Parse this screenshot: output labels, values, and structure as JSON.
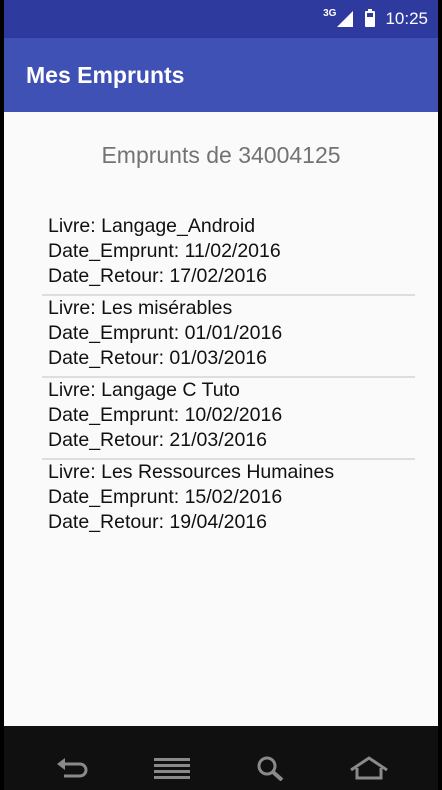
{
  "status_bar": {
    "network_label": "3G",
    "time": "10:25"
  },
  "app_bar": {
    "title": "Mes Emprunts"
  },
  "main": {
    "heading": "Emprunts de 34004125",
    "loans": [
      {
        "livre": "Livre: Langage_Android",
        "date_emprunt": "Date_Emprunt: 11/02/2016",
        "date_retour": "Date_Retour: 17/02/2016"
      },
      {
        "livre": "Livre: Les misérables",
        "date_emprunt": "Date_Emprunt: 01/01/2016",
        "date_retour": "Date_Retour: 01/03/2016"
      },
      {
        "livre": "Livre: Langage C Tuto",
        "date_emprunt": "Date_Emprunt: 10/02/2016",
        "date_retour": "Date_Retour: 21/03/2016"
      },
      {
        "livre": "Livre: Les Ressources Humaines",
        "date_emprunt": "Date_Emprunt: 15/02/2016",
        "date_retour": "Date_Retour: 19/04/2016"
      }
    ]
  },
  "nav_bar": {
    "icons": [
      "back-icon",
      "menu-icon",
      "search-icon",
      "home-icon"
    ]
  },
  "colors": {
    "status_bar": "#2f3a9f",
    "app_bar": "#3f51b5",
    "heading_text": "#737373",
    "divider": "#dedede"
  }
}
